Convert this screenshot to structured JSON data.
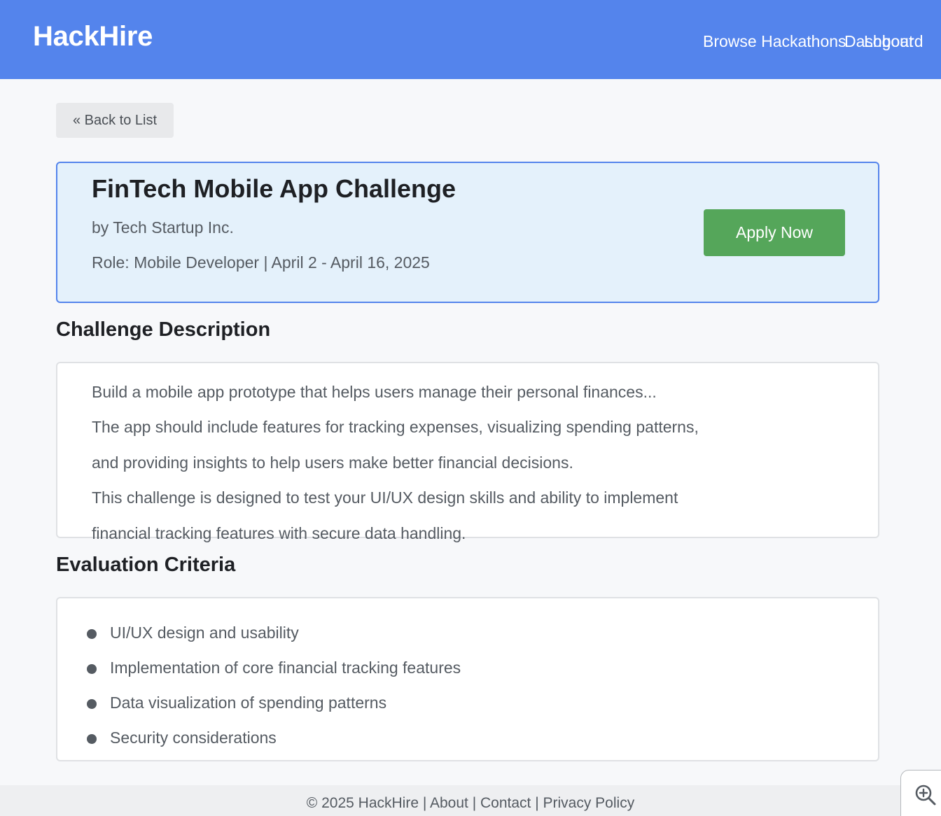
{
  "header": {
    "logo": "HackHire",
    "nav": {
      "browse": "Browse Hackathons",
      "dashboard": "Dashboard",
      "logout": "Logout"
    }
  },
  "back_button": "« Back to List",
  "hackathon": {
    "title": "FinTech Mobile App Challenge",
    "company": "by Tech Startup Inc.",
    "meta": "Role: Mobile Developer | April 2 - April 16, 2025",
    "apply_label": "Apply Now"
  },
  "description": {
    "heading": "Challenge Description",
    "lines": [
      "Build a mobile app prototype that helps users manage their personal finances...",
      "The app should include features for tracking expenses, visualizing spending patterns,",
      "and providing insights to help users make better financial decisions.",
      "This challenge is designed to test your UI/UX design skills and ability to implement",
      "financial tracking features with secure data handling."
    ]
  },
  "evaluation": {
    "heading": "Evaluation Criteria",
    "criteria": [
      "UI/UX design and usability",
      "Implementation of core financial tracking features",
      "Data visualization of spending patterns",
      "Security considerations"
    ]
  },
  "footer": {
    "copyright": "© 2025 HackHire",
    "separator": " | ",
    "about": "About",
    "contact": "Contact",
    "privacy": "Privacy Policy"
  },
  "zoom_icon": "zoom-in-icon",
  "colors": {
    "header_bg": "#5484ec",
    "apply_button": "#55a65a",
    "hero_bg": "#e4f1fb"
  }
}
